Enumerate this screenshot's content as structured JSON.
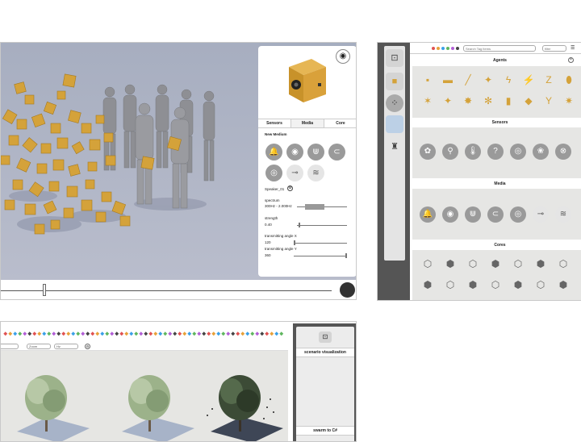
{
  "viewport_window": {
    "panel": {
      "tabs": [
        {
          "label": "Sensors"
        },
        {
          "label": "Media"
        },
        {
          "label": "Core"
        }
      ],
      "section_title": "New Medium",
      "speaker_name": "Speaker_01",
      "props": {
        "spectrum_label": "spectrum",
        "spectrum_value": "300Hz - 2.000Hz",
        "strength_label": "strength",
        "strength_value": "0.40",
        "angle_x_label": "transmitting angle X",
        "angle_x_value": "120",
        "angle_y_label": "transmitting angle Y",
        "angle_y_value": "360"
      }
    }
  },
  "library_window": {
    "search_placeholder": "Search Tag Items",
    "filter_placeholder": "filter",
    "palette": [
      "#e05252",
      "#e8a13a",
      "#3aa0e8",
      "#5fb65f",
      "#b25fd6",
      "#444444"
    ],
    "sections": [
      {
        "title": "Agents"
      },
      {
        "title": "Sensors"
      },
      {
        "title": "Media"
      },
      {
        "title": "Cores"
      }
    ],
    "agents_row1": [
      "▪",
      "▬",
      "╱",
      "✦",
      "ϟ",
      "⚡",
      "Z",
      "⬮"
    ],
    "agents_row2": [
      "✶",
      "✦",
      "✸",
      "✻",
      "▮",
      "◆",
      "Y",
      "✷"
    ],
    "sensors_icons": [
      "✿",
      "⚲",
      "🌡",
      "?",
      "◎",
      "❀",
      "⊗"
    ],
    "media_icons": [
      "🔔",
      "◉",
      "⋓",
      "⊂",
      "◎",
      "⊸",
      "≋"
    ],
    "cores_row1": [
      "⬡",
      "⬢",
      "⬡",
      "⬢",
      "⬡",
      "⬢",
      "⬡"
    ],
    "cores_row2": [
      "⬢",
      "⬡",
      "⬢",
      "⬡",
      "⬢",
      "⬡",
      "⬢"
    ]
  },
  "scenario_window": {
    "panel_title": "scenario visualization",
    "panel_footer": "swarm to C#",
    "inputs": [
      "Zoom",
      "Hz"
    ]
  },
  "colors": {
    "accent_orange": "#d4a23a",
    "dark_panel": "#555555",
    "viewport_bg": "#a9b0c1"
  }
}
